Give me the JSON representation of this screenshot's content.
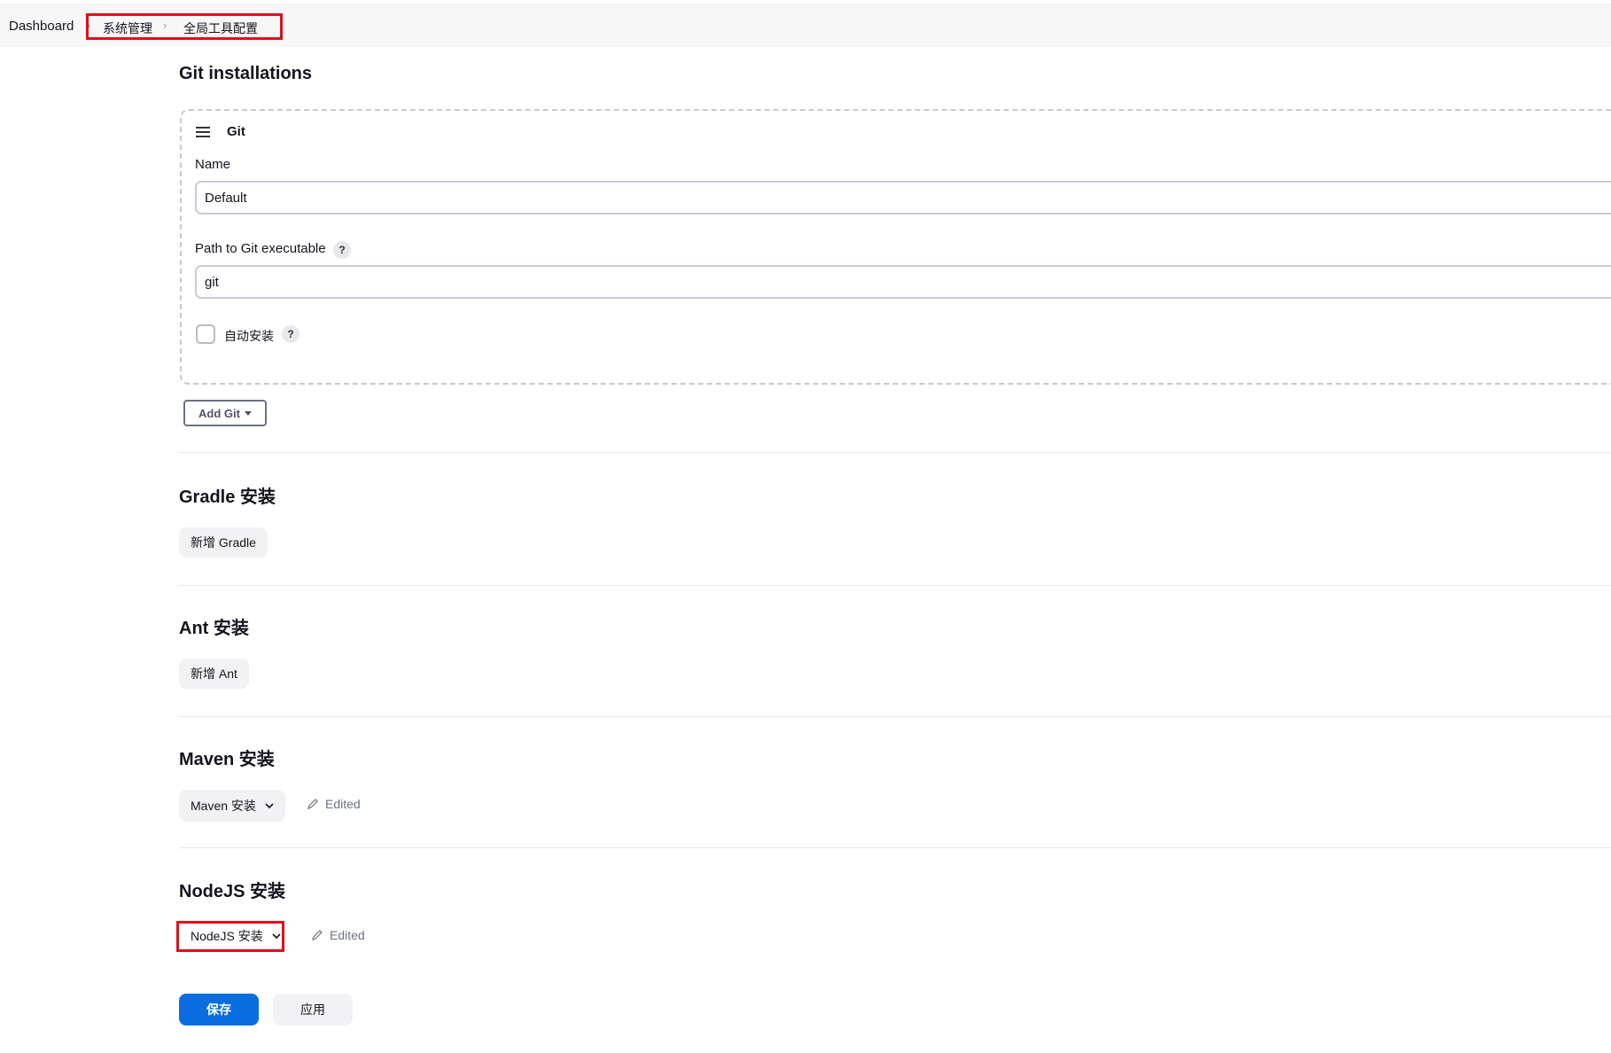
{
  "breadcrumb": {
    "items": [
      "Dashboard",
      "系统管理",
      "全局工具配置"
    ]
  },
  "git_section": {
    "title": "Git installations",
    "entry_title": "Git",
    "name_label": "Name",
    "name_value": "Default",
    "path_label": "Path to Git executable",
    "path_value": "git",
    "auto_install_label": "自动安装",
    "help_symbol": "?",
    "add_button": "Add Git"
  },
  "gradle_section": {
    "title": "Gradle 安装",
    "add_button": "新增 Gradle"
  },
  "ant_section": {
    "title": "Ant 安装",
    "add_button": "新增 Ant"
  },
  "maven_section": {
    "title": "Maven 安装",
    "dropdown_label": "Maven 安装",
    "status": "Edited"
  },
  "nodejs_section": {
    "title": "NodeJS 安装",
    "dropdown_label": "NodeJS 安装",
    "status": "Edited"
  },
  "actions": {
    "save": "保存",
    "apply": "应用"
  },
  "colors": {
    "primary": "#0b6ee0",
    "highlight": "#e0101a"
  },
  "icons": [
    "chevron-right-icon",
    "drag-handle-icon",
    "help-icon",
    "caret-down-icon",
    "chevron-down-icon",
    "pencil-icon"
  ]
}
